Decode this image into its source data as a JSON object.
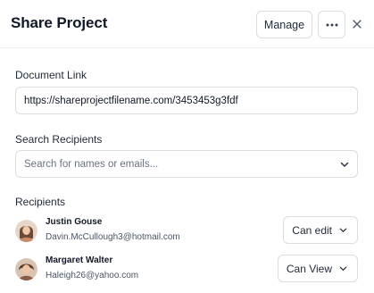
{
  "dialog": {
    "title": "Share Project",
    "manage_label": "Manage",
    "more_icon": "ellipsis-icon",
    "close_icon": "close-icon"
  },
  "document_link": {
    "label": "Document Link",
    "value": "https://shareprojectfilename.com/3453453g3fdf"
  },
  "search": {
    "label": "Search Recipients",
    "placeholder": "Search for names or emails..."
  },
  "recipients": {
    "label": "Recipients",
    "items": [
      {
        "name": "Justin Gouse",
        "email": "Davin.McCullough3@hotmail.com",
        "permission": "Can edit"
      },
      {
        "name": "Margaret Walter",
        "email": "Haleigh26@yahoo.com",
        "permission": "Can View"
      }
    ]
  }
}
